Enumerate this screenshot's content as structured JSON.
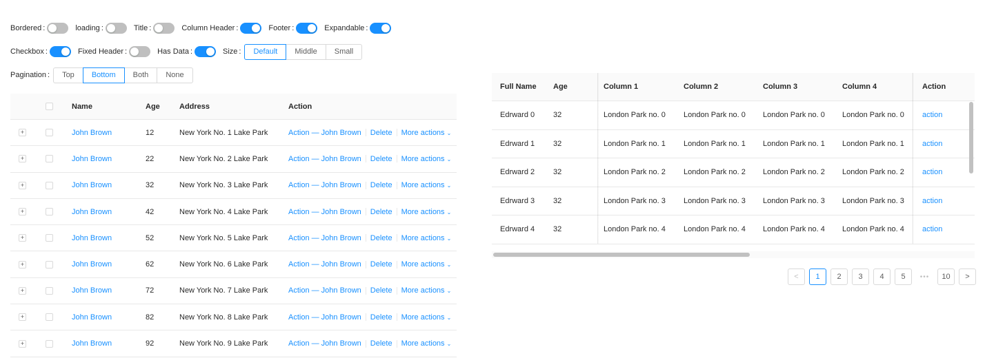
{
  "controls": {
    "row1": [
      {
        "label": "Bordered",
        "on": false
      },
      {
        "label": "loading",
        "on": false
      },
      {
        "label": "Title",
        "on": false
      },
      {
        "label": "Column Header",
        "on": true
      },
      {
        "label": "Footer",
        "on": true
      },
      {
        "label": "Expandable",
        "on": true
      }
    ],
    "row2": [
      {
        "label": "Checkbox",
        "on": true
      },
      {
        "label": "Fixed Header",
        "on": false
      },
      {
        "label": "Has Data",
        "on": true
      }
    ],
    "size": {
      "label": "Size",
      "options": [
        "Default",
        "Middle",
        "Small"
      ],
      "selected": "Default"
    },
    "pagination": {
      "label": "Pagination",
      "options": [
        "Top",
        "Bottom",
        "Both",
        "None"
      ],
      "selected": "Bottom"
    }
  },
  "left_table": {
    "headers": {
      "name": "Name",
      "age": "Age",
      "address": "Address",
      "action": "Action"
    },
    "expand_symbol": "+",
    "rows": [
      {
        "name": "John Brown",
        "age": "12",
        "address": "New York No. 1 Lake Park",
        "action": "Action — John Brown",
        "delete": "Delete",
        "more": "More actions"
      },
      {
        "name": "John Brown",
        "age": "22",
        "address": "New York No. 2 Lake Park",
        "action": "Action — John Brown",
        "delete": "Delete",
        "more": "More actions"
      },
      {
        "name": "John Brown",
        "age": "32",
        "address": "New York No. 3 Lake Park",
        "action": "Action — John Brown",
        "delete": "Delete",
        "more": "More actions"
      },
      {
        "name": "John Brown",
        "age": "42",
        "address": "New York No. 4 Lake Park",
        "action": "Action — John Brown",
        "delete": "Delete",
        "more": "More actions"
      },
      {
        "name": "John Brown",
        "age": "52",
        "address": "New York No. 5 Lake Park",
        "action": "Action — John Brown",
        "delete": "Delete",
        "more": "More actions"
      },
      {
        "name": "John Brown",
        "age": "62",
        "address": "New York No. 6 Lake Park",
        "action": "Action — John Brown",
        "delete": "Delete",
        "more": "More actions"
      },
      {
        "name": "John Brown",
        "age": "72",
        "address": "New York No. 7 Lake Park",
        "action": "Action — John Brown",
        "delete": "Delete",
        "more": "More actions"
      },
      {
        "name": "John Brown",
        "age": "82",
        "address": "New York No. 8 Lake Park",
        "action": "Action — John Brown",
        "delete": "Delete",
        "more": "More actions"
      },
      {
        "name": "John Brown",
        "age": "92",
        "address": "New York No. 9 Lake Park",
        "action": "Action — John Brown",
        "delete": "Delete",
        "more": "More actions"
      }
    ]
  },
  "right_table": {
    "headers": {
      "full_name": "Full Name",
      "age": "Age",
      "col1": "Column 1",
      "col2": "Column 2",
      "col3": "Column 3",
      "col4": "Column 4",
      "action": "Action"
    },
    "rows": [
      {
        "full_name": "Edrward 0",
        "age": "32",
        "col1": "London Park no. 0",
        "col2": "London Park no. 0",
        "col3": "London Park no. 0",
        "col4": "London Park no. 0",
        "action": "action"
      },
      {
        "full_name": "Edrward 1",
        "age": "32",
        "col1": "London Park no. 1",
        "col2": "London Park no. 1",
        "col3": "London Park no. 1",
        "col4": "London Park no. 1",
        "action": "action"
      },
      {
        "full_name": "Edrward 2",
        "age": "32",
        "col1": "London Park no. 2",
        "col2": "London Park no. 2",
        "col3": "London Park no. 2",
        "col4": "London Park no. 2",
        "action": "action"
      },
      {
        "full_name": "Edrward 3",
        "age": "32",
        "col1": "London Park no. 3",
        "col2": "London Park no. 3",
        "col3": "London Park no. 3",
        "col4": "London Park no. 3",
        "action": "action"
      },
      {
        "full_name": "Edrward 4",
        "age": "32",
        "col1": "London Park no. 4",
        "col2": "London Park no. 4",
        "col3": "London Park no. 4",
        "col4": "London Park no. 4",
        "action": "action"
      }
    ]
  },
  "pagination": {
    "prev": "<",
    "next": ">",
    "pages": [
      "1",
      "2",
      "3",
      "4",
      "5"
    ],
    "ellipsis": "•••",
    "last": "10",
    "current": "1"
  },
  "icons": {
    "more_chevron": "chevron-down-icon",
    "prev": "chevron-left-icon",
    "next": "chevron-right-icon"
  },
  "colors": {
    "primary": "#1890ff",
    "switch_off": "#bfbfbf",
    "border": "#e8e8e8",
    "header_bg": "#fafafa"
  }
}
